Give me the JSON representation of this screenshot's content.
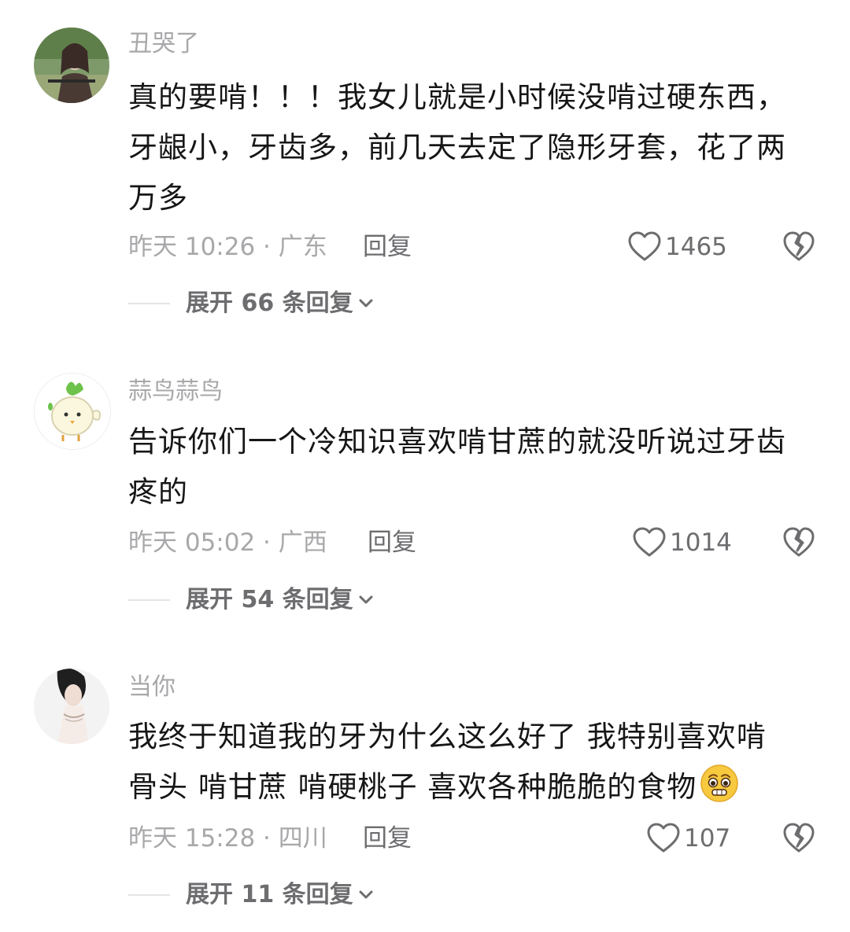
{
  "comments": [
    {
      "username": "丑哭了",
      "lines": [
        "真的要啃！！！我女儿就是小时候没啃过硬东西，",
        "牙龈小，牙齿多，前几天去定了隐形牙套，花了两",
        "万多"
      ],
      "time_location": "昨天 10:26 · 广东",
      "reply_label": "回复",
      "likes": "1465",
      "expand_label": "展开 66 条回复"
    },
    {
      "username": "蒜鸟蒜鸟",
      "lines": [
        "告诉你们一个冷知识喜欢啃甘蔗的就没听说过牙齿",
        "疼的"
      ],
      "time_location": "昨天 05:02 · 广西",
      "reply_label": "回复",
      "likes": "1014",
      "expand_label": "展开 54 条回复"
    },
    {
      "username": "当你",
      "lines": [
        "我终于知道我的牙为什么这么好了 我特别喜欢啃",
        "骨头 啃甘蔗 啃硬桃子 喜欢各种脆脆的食物"
      ],
      "time_location": "昨天 15:28 · 四川",
      "reply_label": "回复",
      "likes": "107",
      "expand_label": "展开 11 条回复"
    }
  ],
  "icons": {
    "like": "heart-outline-icon",
    "dislike": "broken-heart-icon",
    "expand": "chevron-down-icon",
    "emoji": "pleading-face-emoji-icon"
  },
  "colors": {
    "text_primary": "#161616",
    "text_secondary": "#a8a8ab",
    "text_action": "#6d6d70",
    "divider": "#e4e4e6"
  }
}
